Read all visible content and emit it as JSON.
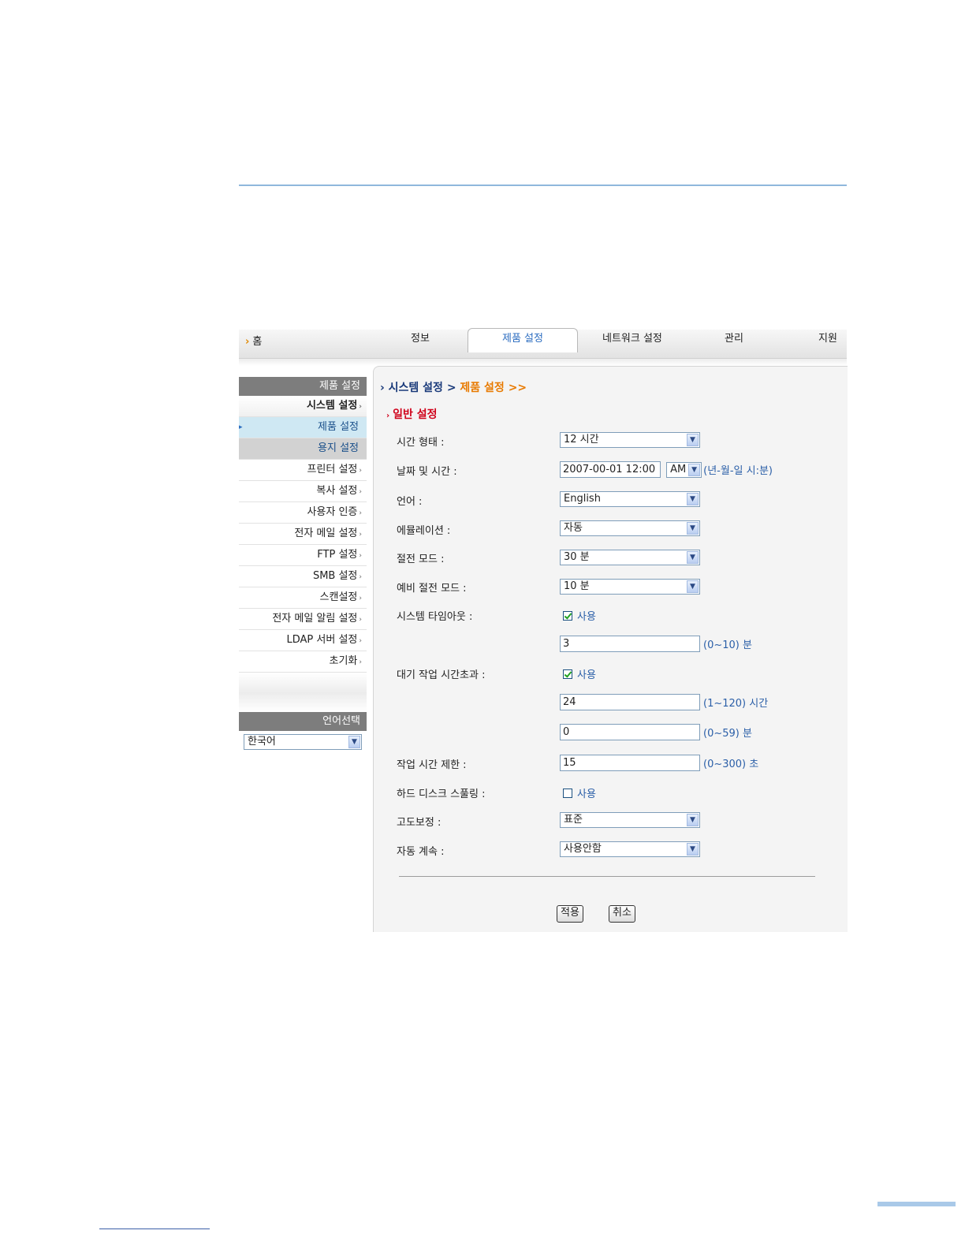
{
  "topnav": {
    "home": "홈",
    "tabs": [
      "정보",
      "제품 설정",
      "네트워크 설정",
      "관리",
      "지원"
    ]
  },
  "sidebar": {
    "header": "제품 설정",
    "items": [
      {
        "label": "시스템 설정",
        "state": "selected"
      },
      {
        "label": "제품 설정",
        "state": "sub-active"
      },
      {
        "label": "용지 설정",
        "state": "sub"
      },
      {
        "label": "프린터 설정"
      },
      {
        "label": "복사 설정"
      },
      {
        "label": "사용자 인증"
      },
      {
        "label": "전자 메일 설정"
      },
      {
        "label": "FTP 설정"
      },
      {
        "label": "SMB 설정"
      },
      {
        "label": "스캔설정"
      },
      {
        "label": "전자 메일 알림 설정"
      },
      {
        "label": "LDAP 서버 설정"
      },
      {
        "label": "초기화"
      }
    ],
    "lang_header": "언어선택",
    "lang_value": "한국어"
  },
  "breadcrumb": {
    "part1": "시스템 설정",
    "sep": ">",
    "part2": "제품 설정 >>"
  },
  "section_title": "일반 설정",
  "form": {
    "time_format": {
      "label": "시간 형태 :",
      "value": "12 시간"
    },
    "datetime": {
      "label": "날짜 및 시간 :",
      "value": "2007-00-01 12:00",
      "ampm": "AM",
      "hint": "(년-월-일 시:분)"
    },
    "language": {
      "label": "언어 :",
      "value": "English"
    },
    "emulation": {
      "label": "에뮬레이션 :",
      "value": "자동"
    },
    "power_save": {
      "label": "절전 모드 :",
      "value": "30 분"
    },
    "standby_power_save": {
      "label": "예비 절전 모드 :",
      "value": "10 분"
    },
    "system_timeout": {
      "label": "시스템 타임아웃 :",
      "checkbox": "사용",
      "checked": true,
      "value": "3",
      "hint": "(0~10) 분"
    },
    "job_timeout": {
      "label": "대기 작업 시간초과 :",
      "checkbox": "사용",
      "checked": true,
      "hours": "24",
      "hours_hint": "(1~120) 시간",
      "minutes": "0",
      "minutes_hint": "(0~59) 분"
    },
    "job_time_limit": {
      "label": "작업 시간 제한 :",
      "value": "15",
      "hint": "(0~300) 초"
    },
    "hdd_spooling": {
      "label": "하드 디스크 스풀링 :",
      "checkbox": "사용",
      "checked": false
    },
    "altitude": {
      "label": "고도보정 :",
      "value": "표준"
    },
    "auto_continue": {
      "label": "자동 계속 :",
      "value": "사용안함"
    }
  },
  "buttons": {
    "apply": "적용",
    "cancel": "취소"
  }
}
